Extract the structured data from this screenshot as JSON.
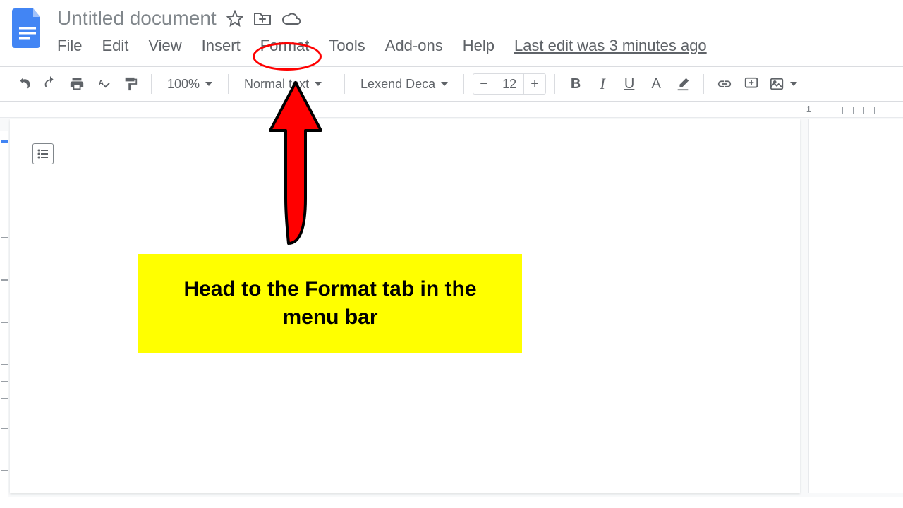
{
  "doc": {
    "title": "Untitled document"
  },
  "menu": {
    "file": "File",
    "edit": "Edit",
    "view": "View",
    "insert": "Insert",
    "format": "Format",
    "tools": "Tools",
    "addons": "Add-ons",
    "help": "Help",
    "last_edit": "Last edit was 3 minutes ago"
  },
  "toolbar": {
    "zoom": "100%",
    "styles": "Normal text",
    "font": "Lexend Deca",
    "font_size": "12"
  },
  "ruler": {
    "mark": "1"
  },
  "annotation": {
    "callout": "Head to the Format tab in the menu bar"
  },
  "colors": {
    "accent": "#4285f4",
    "highlight": "#ffff00",
    "arrow": "#ff0000"
  }
}
